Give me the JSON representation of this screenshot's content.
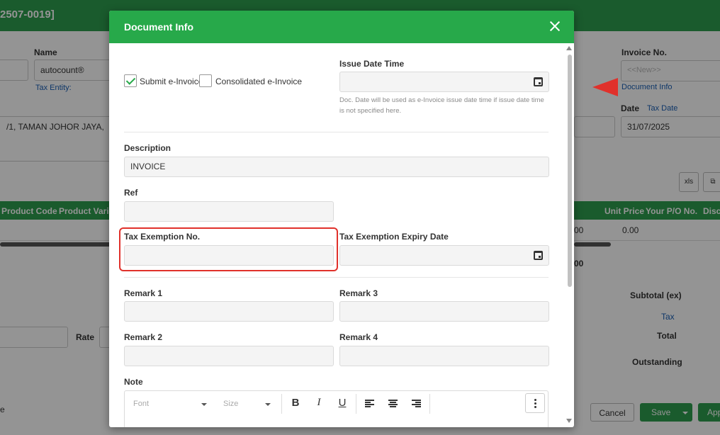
{
  "background": {
    "header_title": "2507-0019]",
    "name_label": "Name",
    "name_value": "autocount®",
    "tax_entity_link": "Tax Entity:",
    "address_text": "/1, TAMAN JOHOR JAYA,",
    "invoice_no_label": "Invoice No.",
    "invoice_no_placeholder": "<<New>>",
    "document_info_link": "Document Info",
    "date_label": "Date",
    "tax_date_link": "Tax Date",
    "date_value": "31/07/2025",
    "grid_columns": [
      "Product Code",
      "Product Variant",
      "Unit Price",
      "Your P/O No.",
      "Disco"
    ],
    "grid_row_unit_price": "0.00",
    "grid_row_partial": "00",
    "total_partial": "00",
    "subtotal_label": "Subtotal (ex)",
    "tax_link": "Tax",
    "total_label": "Total",
    "outstanding_label": "Outstanding",
    "rate_label": "Rate",
    "left_edge_text": "e",
    "cancel_label": "Cancel",
    "save_label": "Save",
    "apply_label": "App",
    "icon_btn_1": "xls",
    "icon_btn_2": "⧉",
    "colors": {
      "brand_green": "#2e9d4f",
      "link_blue": "#1a5fb4",
      "annotation_red": "#e0312b"
    }
  },
  "modal": {
    "title": "Document Info",
    "submit_einvoice_label": "Submit e-Invoice",
    "submit_einvoice_checked": true,
    "consolidated_einvoice_label": "Consolidated e-Invoice",
    "consolidated_einvoice_checked": false,
    "issue_date_time_label": "Issue Date Time",
    "issue_date_time_value": "",
    "issue_date_hint": "Doc. Date will be used as e-Invoice issue date time if issue date time is not specified here.",
    "description_label": "Description",
    "description_value": "INVOICE",
    "ref_label": "Ref",
    "ref_value": "",
    "tax_exemption_no_label": "Tax Exemption No.",
    "tax_exemption_no_value": "",
    "tax_exemption_expiry_label": "Tax Exemption Expiry Date",
    "tax_exemption_expiry_value": "",
    "remark1_label": "Remark 1",
    "remark2_label": "Remark 2",
    "remark3_label": "Remark 3",
    "remark4_label": "Remark 4",
    "remark1_value": "",
    "remark2_value": "",
    "remark3_value": "",
    "remark4_value": "",
    "note_label": "Note",
    "editor": {
      "font_placeholder": "Font",
      "size_placeholder": "Size",
      "bold": "B",
      "italic": "I",
      "underline": "U"
    }
  }
}
